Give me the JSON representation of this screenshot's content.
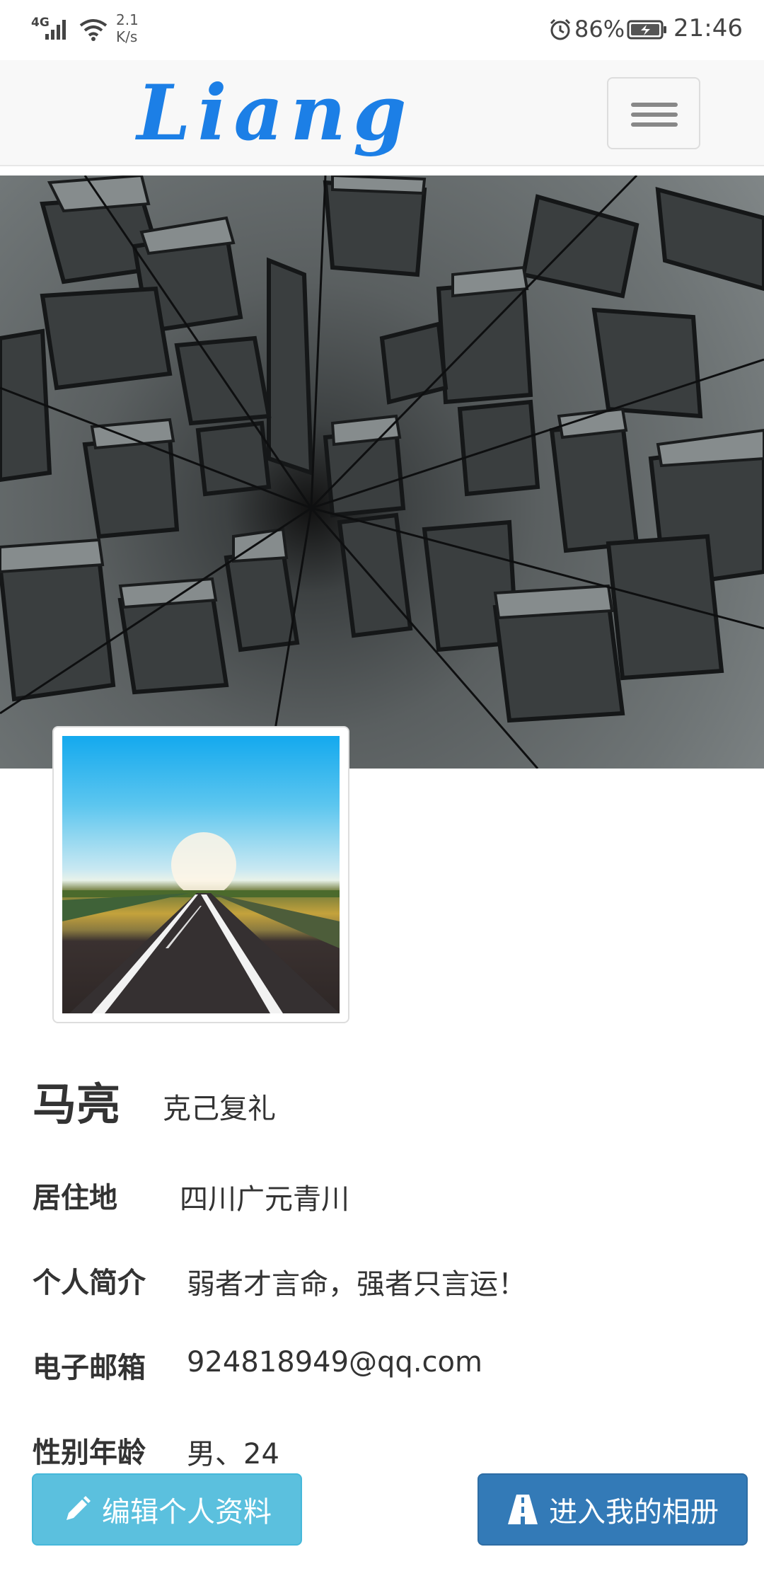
{
  "status_bar": {
    "network": "4G",
    "speed_value": "2.1",
    "speed_unit": "K/s",
    "battery_percent": "86%",
    "time": "21:46"
  },
  "navbar": {
    "brand": "Liang",
    "brand_color": "#1c7fe6"
  },
  "profile": {
    "name": "马亮",
    "motto": "克己复礼",
    "fields": [
      {
        "label": "居住地",
        "value": "四川广元青川"
      },
      {
        "label": "个人简介",
        "value": "弱者才言命，强者只言运！"
      },
      {
        "label": "电子邮箱",
        "value": "924818949@qq.com"
      },
      {
        "label": "性别年龄",
        "value": "男、24"
      }
    ]
  },
  "actions": {
    "edit_label": "编辑个人资料",
    "edit_color": "#5bc0de",
    "album_label": "进入我的相册",
    "album_color": "#337ab7"
  }
}
